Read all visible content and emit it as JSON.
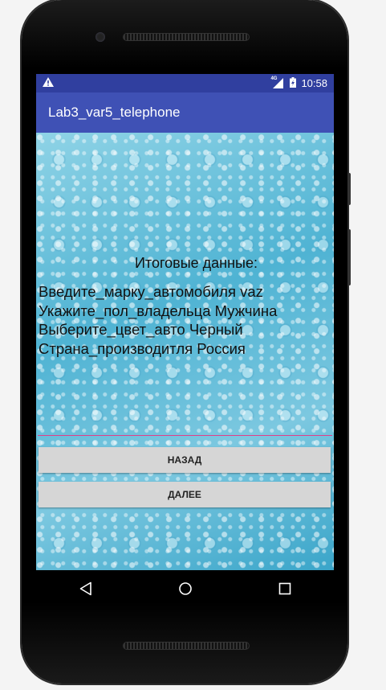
{
  "status_bar": {
    "time": "10:58",
    "network": "4G",
    "icons": [
      "warning-icon",
      "signal-icon",
      "battery-charging-icon"
    ]
  },
  "app_bar": {
    "title": "Lab3_var5_telephone"
  },
  "content": {
    "heading": "Итоговые данные:",
    "lines": [
      "Введите_марку_автомобиля vaz",
      "Укажите_пол_владельца Мужчина",
      "Выберите_цвет_авто Черный",
      "Страна_производитля Россия"
    ],
    "buttons": {
      "back": "НАЗАД",
      "next": "ДАЛЕЕ"
    }
  },
  "colors": {
    "status_bar": "#303F9F",
    "app_bar": "#3F51B5",
    "divider": "#e0408a",
    "button": "#d6d6d6"
  },
  "nav_bar": {
    "icons": [
      "back-icon",
      "home-icon",
      "recents-icon"
    ]
  }
}
